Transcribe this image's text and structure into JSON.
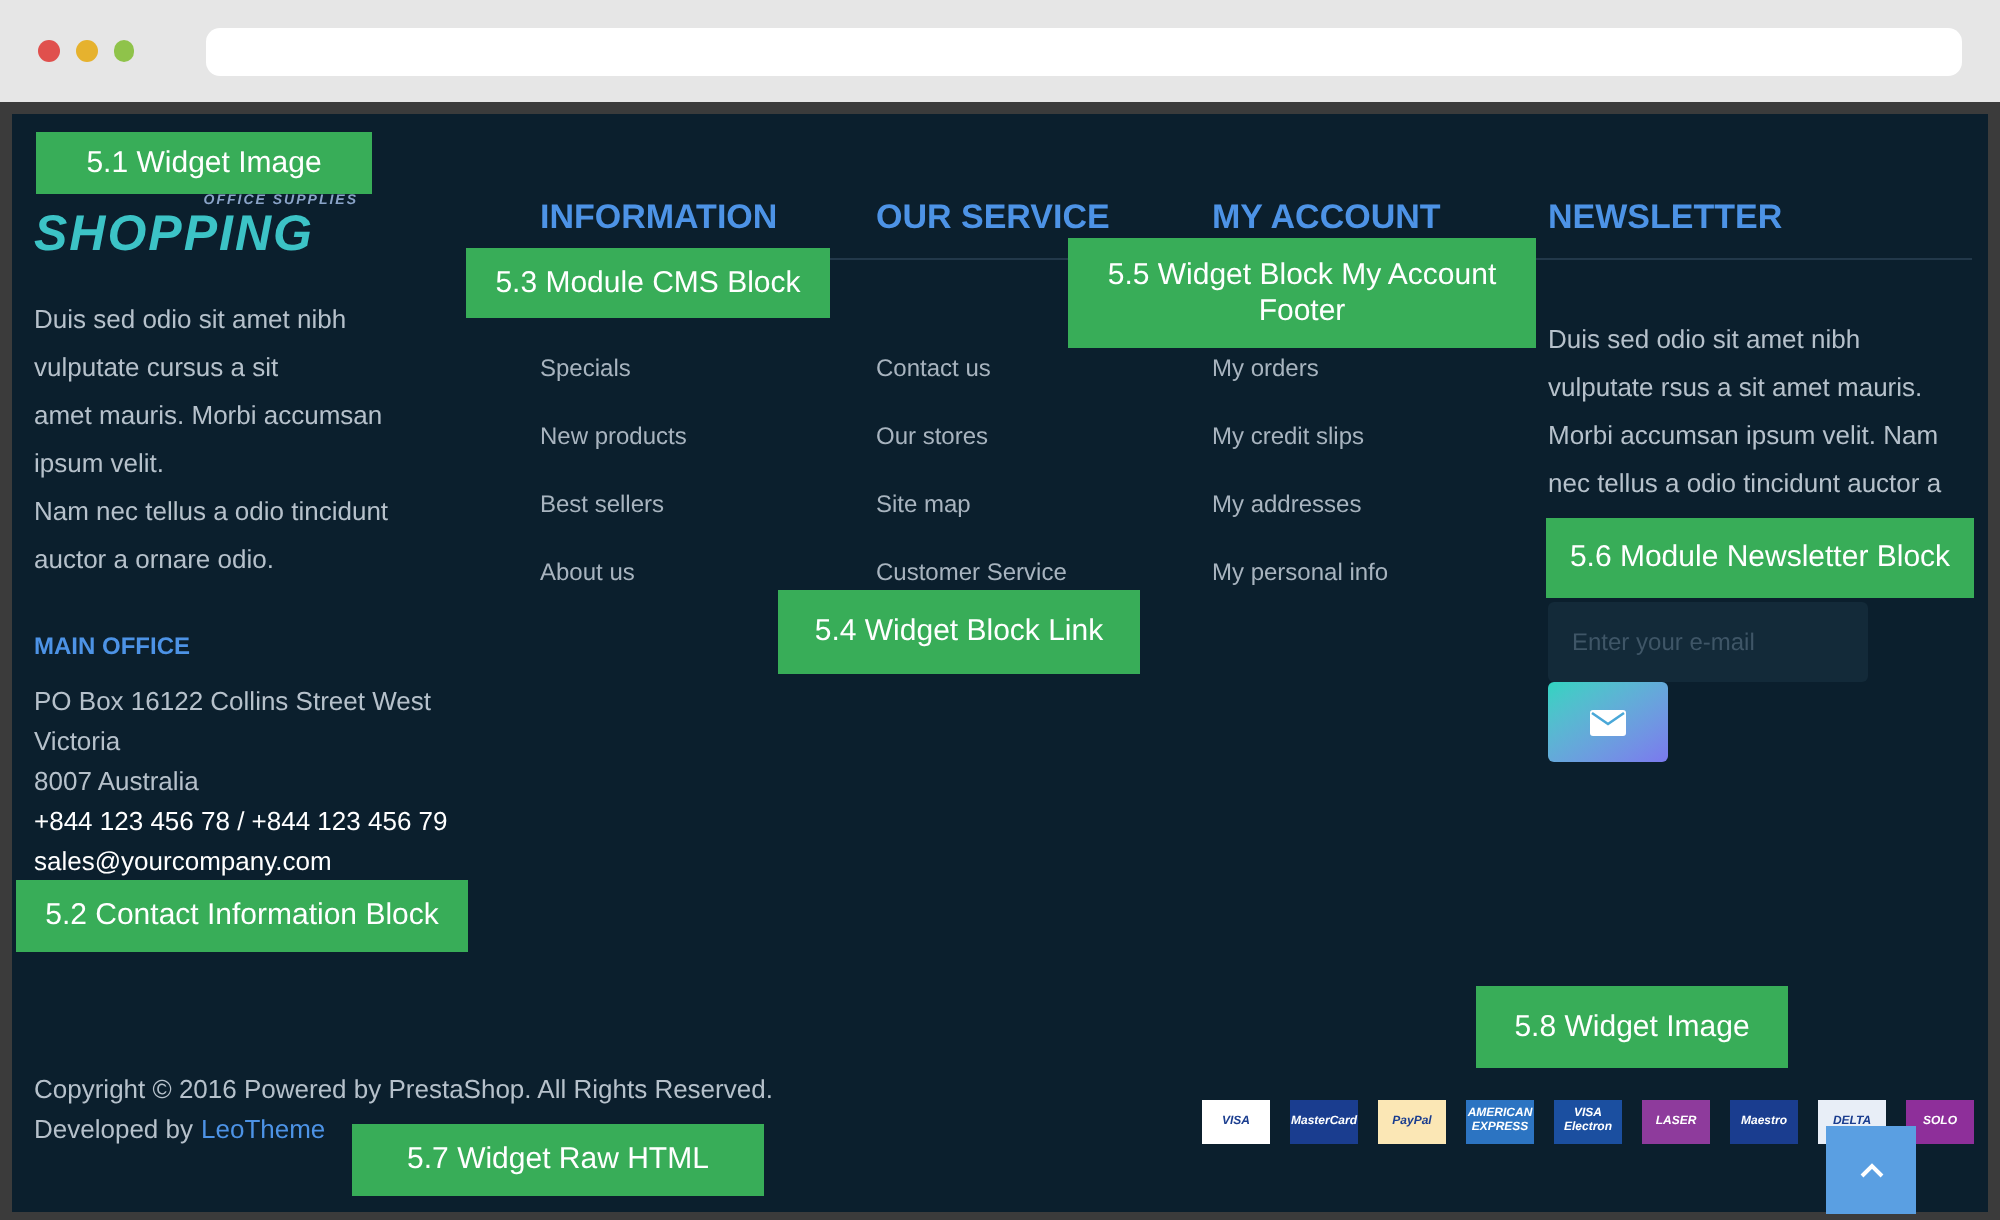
{
  "logo": {
    "tagline": "OFFICE SUPPLIES",
    "title": "SHOPPING"
  },
  "about": [
    "Duis sed odio sit amet nibh vulputate cursus a sit",
    "amet mauris. Morbi accumsan ipsum velit.",
    "Nam nec tellus a odio tincidunt auctor a ornare odio."
  ],
  "main_office": {
    "heading": "MAIN OFFICE",
    "address": [
      "PO Box 16122 Collins Street West",
      "Victoria",
      "8007 Australia"
    ],
    "phone": "+844 123 456 78 / +844 123 456 79",
    "email": "sales@yourcompany.com"
  },
  "link_columns": [
    {
      "heading": "INFORMATION",
      "links": [
        "Specials",
        "New products",
        "Best sellers",
        "About us"
      ]
    },
    {
      "heading": "OUR SERVICE",
      "links": [
        "Contact us",
        "Our stores",
        "Site map",
        "Customer Service"
      ]
    },
    {
      "heading": "MY ACCOUNT",
      "links": [
        "My orders",
        "My credit slips",
        "My addresses",
        "My personal info"
      ]
    }
  ],
  "newsletter": {
    "heading": "NEWSLETTER",
    "text": "Duis sed odio sit amet nibh vulputate rsus a sit amet mauris. Morbi accumsan ipsum velit. Nam nec tellus a odio tincidunt auctor a",
    "placeholder": "Enter your e-mail"
  },
  "copyright": "Copyright © 2016 Powered by PrestaShop. All Rights Reserved.",
  "developed": {
    "text": "Developed by",
    "link": "LeoTheme"
  },
  "payment_cards": [
    {
      "label": "VISA",
      "color": "#ffffff"
    },
    {
      "label": "MasterCard",
      "color": "#1a3d8f"
    },
    {
      "label": "PayPal",
      "color": "#fbe7b5"
    },
    {
      "label": "AMERICAN EXPRESS",
      "color": "#2c74c2"
    },
    {
      "label": "VISA Electron",
      "color": "#1b4fa0"
    },
    {
      "label": "LASER",
      "color": "#8e3b9c"
    },
    {
      "label": "Maestro",
      "color": "#1a3d8f"
    },
    {
      "label": "DELTA",
      "color": "#e8eef7"
    },
    {
      "label": "SOLO",
      "color": "#8e2f9a"
    }
  ],
  "annotations": [
    "5.1 Widget Image",
    "5.2 Contact Information Block",
    "5.3 Module CMS Block",
    "5.4 Widget Block Link",
    "5.5 Widget Block My Account Footer",
    "5.6 Module Newsletter Block",
    "5.7 Widget Raw HTML",
    "5.8 Widget Image"
  ]
}
